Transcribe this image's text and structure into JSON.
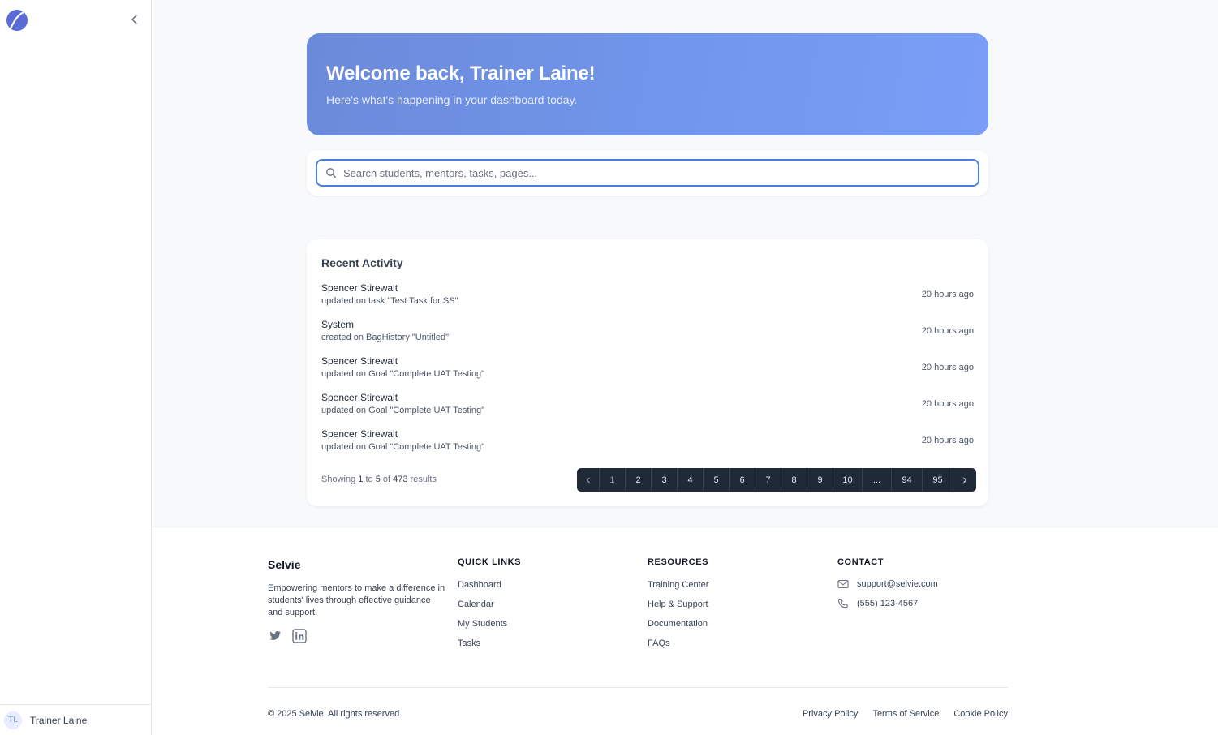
{
  "sidebar": {
    "logo_icon": "crescent-moon-icon",
    "collapse_icon": "chevron-left-icon",
    "user": {
      "initials": "TL",
      "name": "Trainer Laine"
    }
  },
  "hero": {
    "title": "Welcome back, Trainer Laine!",
    "subtitle": "Here's what's happening in your dashboard today."
  },
  "search": {
    "placeholder": "Search students, mentors, tasks, pages...",
    "value": ""
  },
  "activity": {
    "title": "Recent Activity",
    "items": [
      {
        "name": "Spencer Stirewalt",
        "desc": "updated on task \"Test Task for SS\"",
        "time": "20 hours ago"
      },
      {
        "name": "System",
        "desc": "created on BagHistory \"Untitled\"",
        "time": "20 hours ago"
      },
      {
        "name": "Spencer Stirewalt",
        "desc": "updated on Goal \"Complete UAT Testing\"",
        "time": "20 hours ago"
      },
      {
        "name": "Spencer Stirewalt",
        "desc": "updated on Goal \"Complete UAT Testing\"",
        "time": "20 hours ago"
      },
      {
        "name": "Spencer Stirewalt",
        "desc": "updated on Goal \"Complete UAT Testing\"",
        "time": "20 hours ago"
      }
    ],
    "showing": {
      "prefix": "Showing",
      "from": "1",
      "to_word": "to",
      "to": "5",
      "of_word": "of",
      "total": "473",
      "suffix": "results"
    },
    "pagination": {
      "prev_icon": "chevron-left-icon",
      "pages": [
        "1",
        "2",
        "3",
        "4",
        "5",
        "6",
        "7",
        "8",
        "9",
        "10",
        "...",
        "94",
        "95"
      ],
      "current": "1",
      "next_icon": "chevron-right-icon"
    }
  },
  "footer": {
    "brand": "Selvie",
    "description": "Empowering mentors to make a difference in students' lives through effective guidance and support.",
    "social": [
      "twitter-icon",
      "linkedin-icon"
    ],
    "quick_links": {
      "title": "QUICK LINKS",
      "items": [
        "Dashboard",
        "Calendar",
        "My Students",
        "Tasks"
      ]
    },
    "resources": {
      "title": "RESOURCES",
      "items": [
        "Training Center",
        "Help & Support",
        "Documentation",
        "FAQs"
      ]
    },
    "contact": {
      "title": "CONTACT",
      "email": "support@selvie.com",
      "phone": "(555) 123-4567"
    },
    "copyright": "© 2025 Selvie. All rights reserved.",
    "legal": [
      "Privacy Policy",
      "Terms of Service",
      "Cookie Policy"
    ]
  },
  "colors": {
    "accent": "#4a7fe0",
    "hero_start": "#6c8ad9",
    "hero_end": "#7a9ef7",
    "pagination_bg": "#1f2937"
  }
}
